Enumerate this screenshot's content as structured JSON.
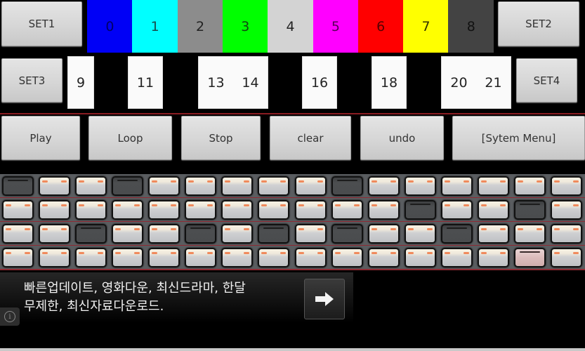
{
  "top_row": {
    "set1_label": "SET1",
    "set2_label": "SET2",
    "colors": [
      {
        "label": "0",
        "color": "#0000f6",
        "text_color": "#000066"
      },
      {
        "label": "1",
        "color": "#00ffff",
        "text_color": "#1a4a4a"
      },
      {
        "label": "2",
        "color": "#8c8c8c",
        "text_color": "#222222"
      },
      {
        "label": "3",
        "color": "#00ff00",
        "text_color": "#114411"
      },
      {
        "label": "4",
        "color": "#d3d3d3",
        "text_color": "#222222"
      },
      {
        "label": "5",
        "color": "#ff00ff",
        "text_color": "#550055"
      },
      {
        "label": "6",
        "color": "#ff0000",
        "text_color": "#550000"
      },
      {
        "label": "7",
        "color": "#ffff00",
        "text_color": "#333300"
      },
      {
        "label": "8",
        "color": "#434343",
        "text_color": "#111111"
      }
    ]
  },
  "key_row": {
    "set3_label": "SET3",
    "set4_label": "SET4",
    "white_keys": [
      {
        "labels": [
          "9"
        ]
      },
      {
        "labels": [
          "11"
        ]
      },
      {
        "labels": [
          "13",
          "14"
        ]
      },
      {
        "labels": [
          "16"
        ]
      },
      {
        "labels": [
          "18"
        ]
      },
      {
        "labels": [
          "20",
          "21"
        ]
      }
    ]
  },
  "controls": {
    "play_label": "Play",
    "loop_label": "Loop",
    "stop_label": "Stop",
    "clear_label": "clear",
    "undo_label": "undo",
    "system_menu_label": "[Sytem Menu]"
  },
  "sequencer": {
    "columns": 16,
    "rows": [
      [
        "off",
        "on",
        "on",
        "off",
        "on",
        "on",
        "on",
        "on",
        "on",
        "off",
        "on",
        "on",
        "on",
        "on",
        "on",
        "on"
      ],
      [
        "on",
        "on",
        "on",
        "on",
        "on",
        "on",
        "on",
        "on",
        "on",
        "on",
        "on",
        "off",
        "on",
        "on",
        "off",
        "on"
      ],
      [
        "on",
        "on",
        "off",
        "on",
        "on",
        "off",
        "on",
        "off",
        "on",
        "off",
        "on",
        "on",
        "off",
        "on",
        "on",
        "on"
      ],
      [
        "on",
        "on",
        "on",
        "on",
        "on",
        "on",
        "on",
        "on",
        "on",
        "on",
        "on",
        "on",
        "on",
        "on",
        "pressed",
        "on"
      ]
    ]
  },
  "ad": {
    "line1": "빠른업데이트, 영화다운, 최신드라마, 한달",
    "line2": "무제한, 최신자료다운로드.",
    "arrow_icon": "arrow-right-icon",
    "info_icon": "info-icon"
  }
}
